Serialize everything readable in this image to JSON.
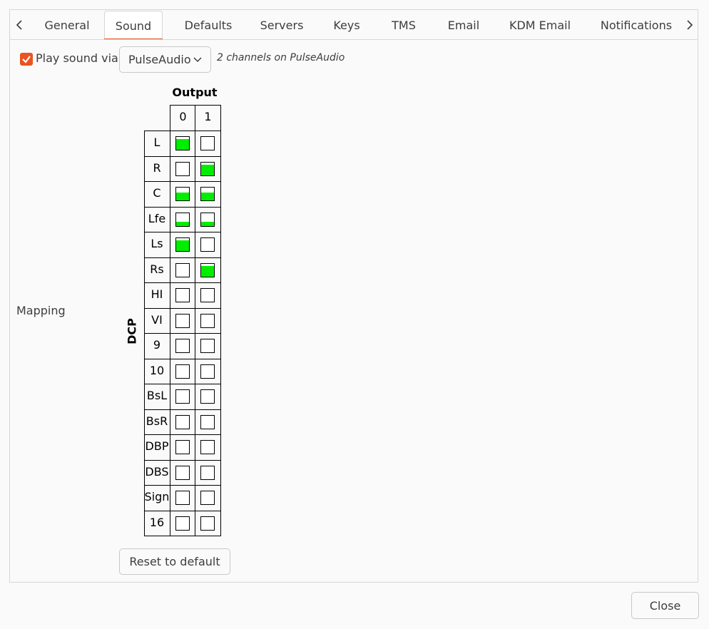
{
  "tabs": [
    {
      "label": "General",
      "active": false
    },
    {
      "label": "Sound",
      "active": true
    },
    {
      "label": "Defaults",
      "active": false
    },
    {
      "label": "Servers",
      "active": false
    },
    {
      "label": "Keys",
      "active": false
    },
    {
      "label": "TMS",
      "active": false
    },
    {
      "label": "Email",
      "active": false
    },
    {
      "label": "KDM Email",
      "active": false
    },
    {
      "label": "Notifications",
      "active": false
    }
  ],
  "sound": {
    "play_sound_label": "Play sound via",
    "play_sound_checked": true,
    "device_selected": "PulseAudio",
    "channels_info": "2 channels on PulseAudio",
    "mapping_label": "Mapping",
    "output_label": "Output",
    "dcp_label": "DCP",
    "output_channels": [
      "0",
      "1"
    ],
    "dcp_channels": [
      "L",
      "R",
      "C",
      "Lfe",
      "Ls",
      "Rs",
      "HI",
      "VI",
      "9",
      "10",
      "BsL",
      "BsR",
      "DBP",
      "DBS",
      "Sign",
      "16"
    ],
    "gain_levels": [
      [
        0.85,
        0.0
      ],
      [
        0.0,
        0.85
      ],
      [
        0.6,
        0.6
      ],
      [
        0.35,
        0.35
      ],
      [
        0.85,
        0.0
      ],
      [
        0.0,
        0.85
      ],
      [
        0.0,
        0.0
      ],
      [
        0.0,
        0.0
      ],
      [
        0.0,
        0.0
      ],
      [
        0.0,
        0.0
      ],
      [
        0.0,
        0.0
      ],
      [
        0.0,
        0.0
      ],
      [
        0.0,
        0.0
      ],
      [
        0.0,
        0.0
      ],
      [
        0.0,
        0.0
      ],
      [
        0.0,
        0.0
      ]
    ],
    "reset_button": "Reset to default",
    "fill_color": "#00ee00"
  },
  "footer": {
    "close_button": "Close"
  },
  "colors": {
    "accent": "#e95420"
  }
}
